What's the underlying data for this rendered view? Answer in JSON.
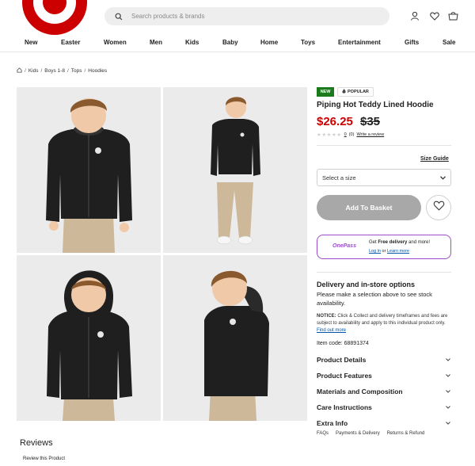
{
  "header": {
    "search_placeholder": "Search products & brands",
    "nav": [
      "New",
      "Easter",
      "Women",
      "Men",
      "Kids",
      "Baby",
      "Home",
      "Toys",
      "Entertainment",
      "Gifts",
      "Sale"
    ]
  },
  "breadcrumb": [
    "Kids",
    "Boys 1-8",
    "Tops",
    "Hoodies"
  ],
  "product": {
    "badge_new": "NEW",
    "badge_popular": "POPULAR",
    "title": "Piping Hot Teddy Lined Hoodie",
    "price": "$26.25",
    "was_price": "$35",
    "stars": "★★★★★",
    "rating_count": "0",
    "rating_paren": "(0)",
    "write_review": "Write a review",
    "size_guide": "Size Guide",
    "size_select": "Select a size",
    "add_to_basket": "Add To Basket"
  },
  "onepass": {
    "logo": "OnePass",
    "line1_pre": "Get ",
    "line1_bold": "Free delivery",
    "line1_post": " and more!",
    "login": "Log in",
    "or": "or",
    "learn_more": "Learn more"
  },
  "delivery": {
    "title": "Delivery and in-store options",
    "text": "Please make a selection above to see stock availability.",
    "notice_label": "NOTICE:",
    "notice_text": " Click & Collect and delivery timeframes and fees are subject to availability and apply to this individual product only. ",
    "find_out_more": "Find out more",
    "item_code": "Item code: 68891374"
  },
  "accordions": [
    "Product Details",
    "Product Features",
    "Materials and Composition",
    "Care Instructions",
    "Extra Info"
  ],
  "footer_links": [
    "FAQs",
    "Payments & Delivery",
    "Returns & Refund"
  ],
  "reviews": {
    "title": "Reviews",
    "review_link": "Review this Product"
  },
  "colors": {
    "brand": "#cc0000",
    "onepass": "#9b4dca",
    "badge_new": "#1b7a1b",
    "button_disabled": "#a8a8a8"
  }
}
